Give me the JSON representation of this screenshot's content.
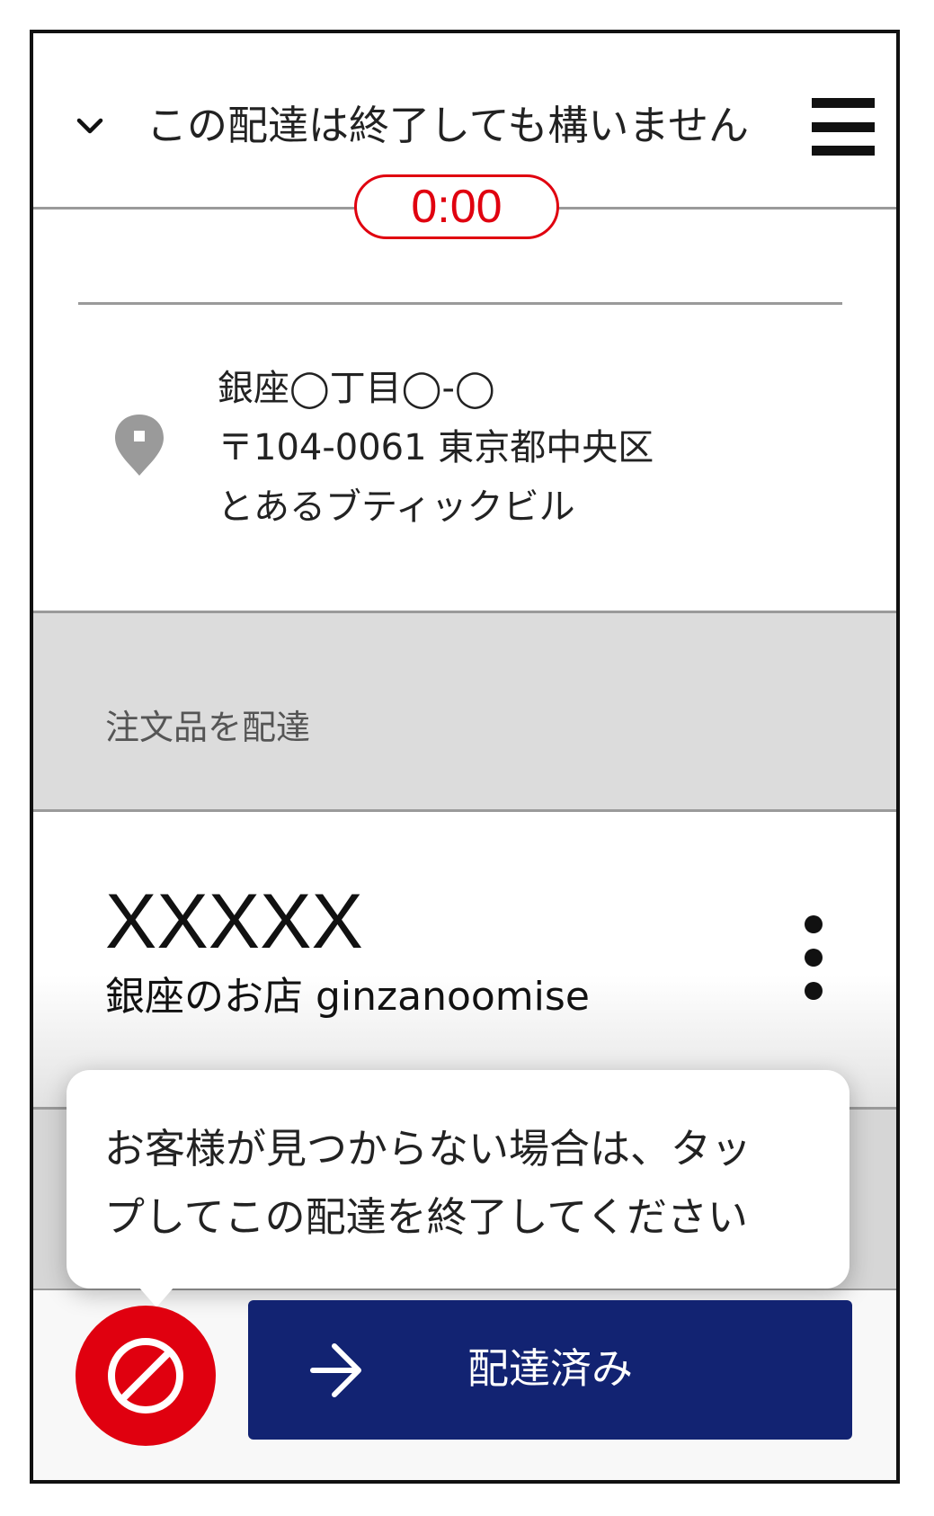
{
  "header": {
    "title": "この配達は終了しても構いません",
    "timer": "0:00"
  },
  "address": {
    "line1": "銀座◯丁目◯-◯",
    "line2": "〒104-0061 東京都中央区",
    "line3": "とあるブティックビル"
  },
  "section": {
    "label": "注文品を配達"
  },
  "order": {
    "id": "XXXXX",
    "store": "銀座のお店 ginzanoomise"
  },
  "tooltip": {
    "line1": "お客様が見つからない場合は、タッ",
    "line2": "プしてこの配達を終了してください"
  },
  "actions": {
    "delivered_label": "配達済み"
  },
  "colors": {
    "accent_red": "#e0000f",
    "primary_blue": "#122372",
    "section_gray": "#dcdcdc"
  },
  "icons": {
    "collapse": "chevron-down-icon",
    "menu": "hamburger-menu-icon",
    "location": "location-pin-icon",
    "more": "more-vertical-icon",
    "cancel": "no-entry-icon",
    "proceed": "arrow-right-icon"
  }
}
